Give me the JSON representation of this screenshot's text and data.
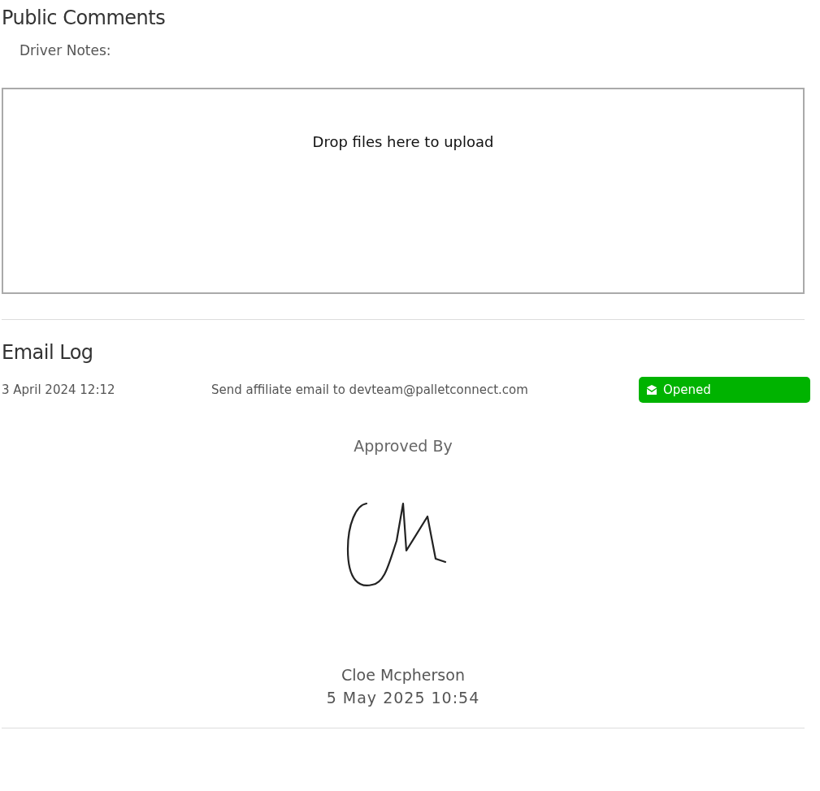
{
  "public_comments": {
    "title": "Public Comments",
    "driver_notes_label": "Driver Notes:",
    "dropzone": {
      "text": "Drop files here to upload"
    }
  },
  "email_log": {
    "title": "Email Log",
    "entries": [
      {
        "date": "3 April 2024 12:12",
        "description": "Send affiliate email to devteam@palletconnect.com",
        "status": "Opened",
        "color": "#00b300"
      }
    ]
  },
  "approval": {
    "title": "Approved By",
    "name": "Cloe Mcpherson",
    "date": "5 May 2025 10:54"
  }
}
